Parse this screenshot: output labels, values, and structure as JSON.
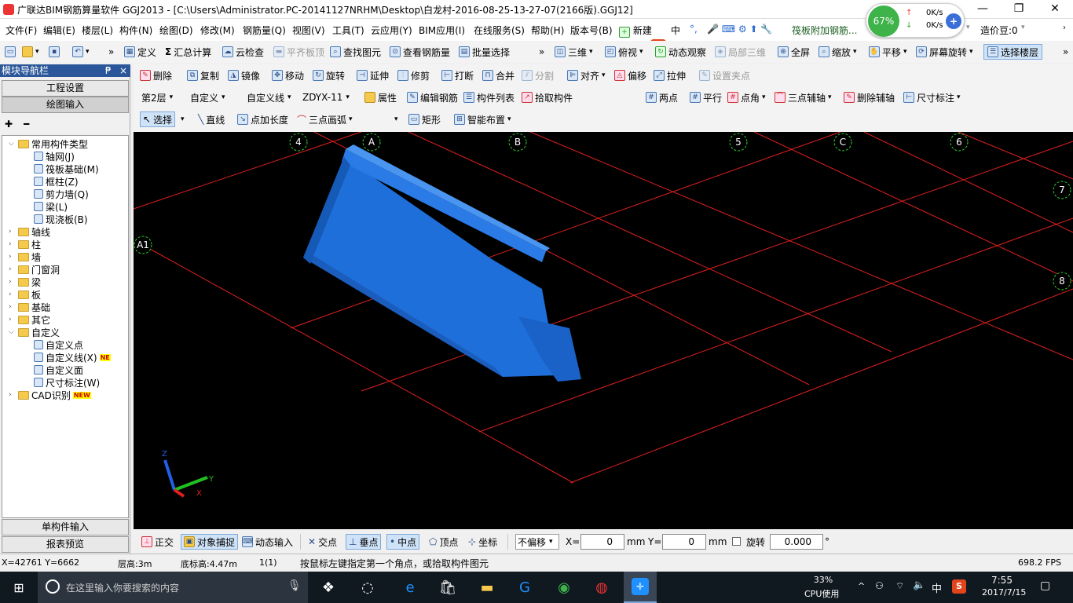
{
  "window": {
    "title": "广联达BIM钢筋算量软件 GGJ2013 - [C:\\Users\\Administrator.PC-20141127NRHM\\Desktop\\白龙村-2016-08-25-13-27-07(2166版).GGJ12]",
    "min": "—",
    "max": "❐",
    "close": "✕"
  },
  "menu": [
    "文件(F)",
    "编辑(E)",
    "楼层(L)",
    "构件(N)",
    "绘图(D)",
    "修改(M)",
    "钢筋量(Q)",
    "视图(V)",
    "工具(T)",
    "云应用(Y)",
    "BIM应用(I)",
    "在线服务(S)",
    "帮助(H)",
    "版本号(B)",
    "新建",
    "中"
  ],
  "menu_right": {
    "promo": "筏板附加钢筋...",
    "bean": "造价豆:0"
  },
  "ime": {
    "s": "S",
    "lang": "中",
    "dot": "°,"
  },
  "netspeed": {
    "percent": "67%",
    "up": "0K/s",
    "down": "0K/s"
  },
  "toolbar1": {
    "define": "定义",
    "sum": "汇总计算",
    "cloud": "云检查",
    "flat": "平齐板顶",
    "find": "查找图元",
    "view_rebar": "查看钢筋量",
    "batch": "批量选择",
    "three_d": "三维",
    "top_view": "俯视",
    "orbit": "动态观察",
    "local3d": "局部三维",
    "fullscreen": "全屏",
    "zoom": "缩放",
    "pan": "平移",
    "rotate": "屏幕旋转",
    "select_floor": "选择楼层"
  },
  "toolbar2": {
    "delete": "删除",
    "copy": "复制",
    "mirror": "镜像",
    "move": "移动",
    "rotate": "旋转",
    "extend": "延伸",
    "trim": "修剪",
    "break": "打断",
    "merge": "合并",
    "split": "分割",
    "align": "对齐",
    "offset": "偏移",
    "stretch": "拉伸",
    "grip": "设置夹点"
  },
  "toolbar3": {
    "floor": "第2层",
    "type": "自定义",
    "subtype": "自定义线",
    "element": "ZDYX-11",
    "props": "属性",
    "edit_rebar": "编辑钢筋",
    "list": "构件列表",
    "pick": "拾取构件",
    "twopoint": "两点",
    "parallel": "平行",
    "angle": "点角",
    "threepoint": "三点辅轴",
    "del_aux": "删除辅轴",
    "dim": "尺寸标注"
  },
  "toolbar4": {
    "select": "选择",
    "line": "直线",
    "ptlen": "点加长度",
    "arc": "三点画弧",
    "rect": "矩形",
    "smart": "智能布置"
  },
  "panel": {
    "title": "模块导航栏",
    "pin": "₱",
    "close": "×",
    "proj": "工程设置",
    "draw": "绘图输入",
    "single": "单构件输入",
    "report": "报表预览",
    "expand": "✚",
    "collapse": "━"
  },
  "tree": [
    {
      "label": "常用构件类型",
      "level": 0,
      "exp": "⌵",
      "folder": true
    },
    {
      "label": "轴网(J)",
      "level": 2
    },
    {
      "label": "筏板基础(M)",
      "level": 2
    },
    {
      "label": "框柱(Z)",
      "level": 2
    },
    {
      "label": "剪力墙(Q)",
      "level": 2
    },
    {
      "label": "梁(L)",
      "level": 2
    },
    {
      "label": "现浇板(B)",
      "level": 2
    },
    {
      "label": "轴线",
      "level": 0,
      "exp": "›",
      "folder": true
    },
    {
      "label": "柱",
      "level": 0,
      "exp": "›",
      "folder": true
    },
    {
      "label": "墙",
      "level": 0,
      "exp": "›",
      "folder": true
    },
    {
      "label": "门窗洞",
      "level": 0,
      "exp": "›",
      "folder": true
    },
    {
      "label": "梁",
      "level": 0,
      "exp": "›",
      "folder": true
    },
    {
      "label": "板",
      "level": 0,
      "exp": "›",
      "folder": true
    },
    {
      "label": "基础",
      "level": 0,
      "exp": "›",
      "folder": true
    },
    {
      "label": "其它",
      "level": 0,
      "exp": "›",
      "folder": true
    },
    {
      "label": "自定义",
      "level": 0,
      "exp": "⌵",
      "folder": true
    },
    {
      "label": "自定义点",
      "level": 2
    },
    {
      "label": "自定义线(X)",
      "level": 2,
      "badge": "NE"
    },
    {
      "label": "自定义面",
      "level": 2
    },
    {
      "label": "尺寸标注(W)",
      "level": 2
    },
    {
      "label": "CAD识别",
      "level": 0,
      "exp": "›",
      "folder": true,
      "badge": "NEW"
    }
  ],
  "axes": {
    "top": [
      "4",
      "A",
      "B",
      "5",
      "C",
      "6"
    ],
    "right": [
      "7",
      "8"
    ],
    "left": [
      "A1"
    ]
  },
  "triad": {
    "z": "Z",
    "y": "Y",
    "x": "X"
  },
  "snapbar": {
    "ortho": "正交",
    "snap": "对象捕捉",
    "dyn": "动态输入",
    "intersect": "交点",
    "perp": "垂点",
    "mid": "中点",
    "vertex": "顶点",
    "coord": "坐标",
    "offset_mode": "不偏移",
    "x_label": "X=",
    "x_val": "0",
    "mm1": "mm",
    "y_label": "Y=",
    "y_val": "0",
    "mm2": "mm",
    "rot_label": "旋转",
    "rot_val": "0.000",
    "deg": "°"
  },
  "status": {
    "coords": "X=42761 Y=6662",
    "floor_h": "层高:3m",
    "base_h": "底标高:4.47m",
    "count": "1(1)",
    "hint": "按鼠标左键指定第一个角点，或拾取构件图元",
    "fps": "698.2 FPS"
  },
  "taskbar": {
    "search": "在这里输入你要搜索的内容",
    "cpu_pct": "33%",
    "cpu_label": "CPU使用",
    "ime": "中",
    "time": "7:55",
    "date": "2017/7/15"
  },
  "colors": {
    "accent": "#2b579a",
    "grid": "#e02020",
    "model": "#1e6fd9",
    "canvas": "#000000"
  }
}
